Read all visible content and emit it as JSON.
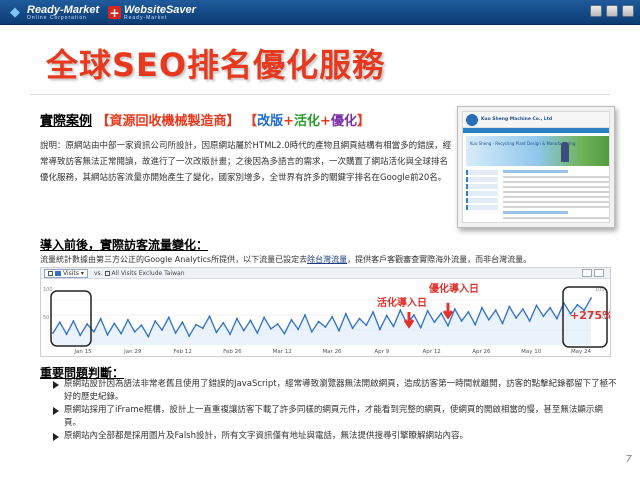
{
  "brand": {
    "logo1_name": "Ready-Market",
    "logo1_sub": "Online Corporation",
    "logo2_name": "WebsiteSaver",
    "logo2_sub": "Ready-Market",
    "logo2_glyph": "+"
  },
  "title": "全球SEO排名優化服務",
  "case": {
    "label": "實際案例",
    "industry": "【資源回收機械製造商】",
    "open_bracket": "【",
    "k1": "改版",
    "plus1": "+",
    "k2": "活化",
    "plus2": "+",
    "k3": "優化",
    "close_bracket": "】"
  },
  "description": "說明：原網站由中部一家資訊公司所設計，因原網站屬於HTML2.0時代的產物且網頁結構有相當多的錯誤，經常導致訪客無法正常閱讀，故進行了一次改版計畫；之後因為多語言的需求，一次購置了網站活化與全球排名優化服務，其網站訪客流量亦開始產生了變化，國家別增多，全世界有許多的關鍵字排名在Google前20名。",
  "thumbnail": {
    "company": "Kuo Sheng Machine Co., Ltd",
    "hero_text": "Kuo Sheng - Recycling Plant Design & Manufacturing"
  },
  "traffic": {
    "heading": "導入前後，實際訪客流量變化：",
    "note_prefix": "流量統計數據由第三方公正的Google Analytics所提供，以下流量已設定去",
    "note_exclude": "除台灣流量",
    "note_suffix": "，提供客戶客觀審查實際海外流量，而非台灣流量。"
  },
  "analytics": {
    "selector_label": "Visits",
    "segment_label": "All Visits Exclude Taiwan",
    "vs_label": "vs.",
    "scale_top": "100",
    "scale_mid": "50",
    "scale_mid_right": "50",
    "scale_top_right": "100",
    "annotation_optimize": "優化導入日",
    "annotation_activate": "活化導入日",
    "growth": "+275%"
  },
  "chart_data": {
    "type": "line",
    "title": "",
    "xlabel": "",
    "ylabel": "",
    "ylim": [
      0,
      100
    ],
    "x_ticks": [
      "Jan 15",
      "Jan 29",
      "Feb 12",
      "Feb 26",
      "Mar 12",
      "Mar 26",
      "Apr 9",
      "Apr 12",
      "Apr 26",
      "May 10",
      "May 24"
    ],
    "series": [
      {
        "values": [
          20,
          38,
          18,
          40,
          16,
          35,
          22,
          44,
          17,
          36,
          19,
          42,
          22,
          33,
          14,
          40,
          25,
          46,
          20,
          38,
          15,
          34,
          28,
          48,
          21,
          37,
          18,
          44,
          24,
          41,
          20,
          46,
          27,
          35,
          19,
          42,
          26,
          50,
          22,
          39,
          30,
          47,
          24,
          52,
          28,
          44,
          33,
          55,
          26,
          49,
          31,
          58,
          35,
          50,
          29,
          57,
          38,
          53,
          32,
          60,
          40,
          55,
          34,
          62,
          42,
          58,
          36,
          64,
          45,
          60,
          40,
          66,
          48,
          62,
          44,
          70,
          52,
          67,
          58,
          78
        ]
      }
    ],
    "grid": true
  },
  "problems": {
    "heading": "重要問題判斷：",
    "items": [
      "原網站設計因為語法非常老舊且使用了錯誤的JavaScript，經常導致瀏覽器無法開啟網頁，造成訪客第一時間就離開，訪客的點擊紀錄都留下了極不好的歷史紀錄。",
      "原網站採用了iFrame框構，設計上一直重複讓訪客下載了許多同樣的網頁元件，才能看到完整的網頁，使網頁的開啟相當的慢，甚至無法顯示網頁。",
      "原網站內全部都是採用圖片及Falsh設計，所有文字資訊僅有地址與電話，無法提供搜尋引擎瞭解網站內容。"
    ]
  },
  "page_number": "7"
}
